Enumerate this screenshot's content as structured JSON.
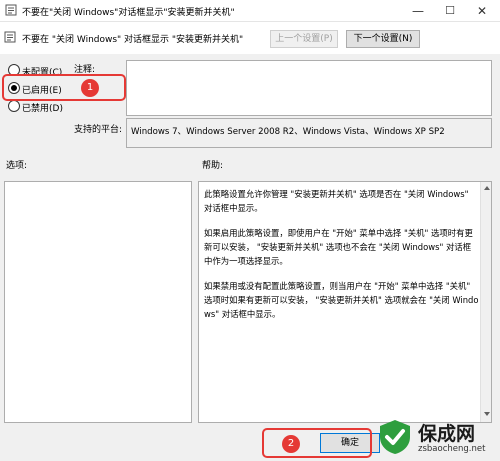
{
  "window": {
    "title": "不要在\"关闭 Windows\"对话框显示\"安装更新并关机\"",
    "minimize": "—",
    "maximize": "☐",
    "close": "✕"
  },
  "header": {
    "policy_title": "不要在 \"关闭 Windows\" 对话框显示 \"安装更新并关机\"",
    "prev_button": "上一个设置(P)",
    "next_button": "下一个设置(N)"
  },
  "state": {
    "not_configured": "未配置(C)",
    "enabled": "已启用(E)",
    "disabled": "已禁用(D)",
    "selected": "enabled"
  },
  "comment": {
    "label": "注释:",
    "value": ""
  },
  "platform": {
    "label": "支持的平台:",
    "value": "Windows 7、Windows Server 2008 R2、Windows Vista、Windows XP SP2"
  },
  "options": {
    "label": "选项:"
  },
  "help": {
    "label": "帮助:",
    "paragraphs": [
      "此策略设置允许你管理 \"安装更新并关机\" 选项是否在 \"关闭 Windows\" 对话框中显示。",
      "如果启用此策略设置，即使用户在 \"开始\" 菜单中选择 \"关机\" 选项时有更新可以安装， \"安装更新并关机\" 选项也不会在 \"关闭 Windows\" 对话框中作为一项选择显示。",
      "如果禁用或没有配置此策略设置，则当用户在 \"开始\" 菜单中选择 \"关机\" 选项时如果有更新可以安装， \"安装更新并关机\" 选项就会在 \"关闭 Windows\" 对话框中显示。"
    ]
  },
  "footer": {
    "ok_button": "确定"
  },
  "annotations": {
    "marker1": "1",
    "marker2": "2"
  },
  "watermark": {
    "name": "保成网",
    "domain": "zsbaocheng.net"
  },
  "colors": {
    "highlight_red": "#e53935",
    "watermark_green": "#2e9e3e",
    "dialog_bg": "#f0f0f0"
  }
}
